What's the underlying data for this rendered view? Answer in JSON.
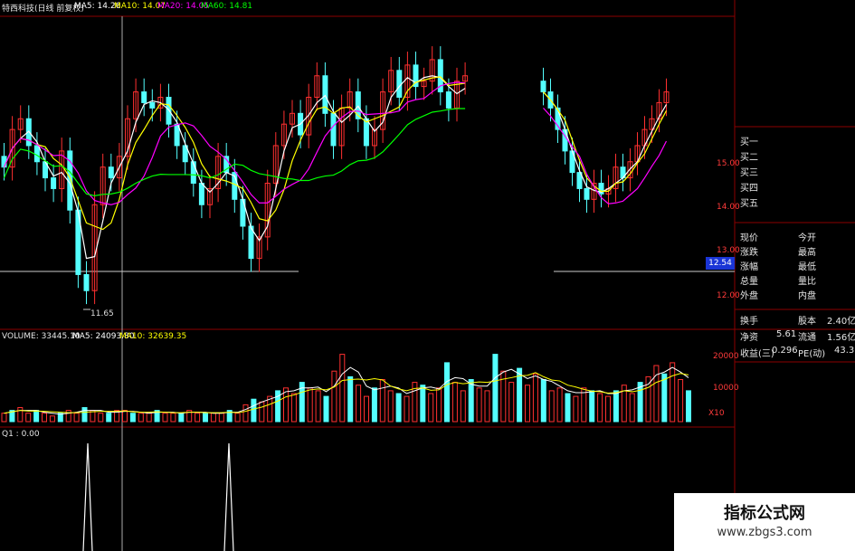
{
  "header": {
    "title": "特西科技(日线 前复权)",
    "ma5": "MA5: 14.26",
    "ma10": "MA10: 14.07",
    "ma20": "MA20: 14.05",
    "ma60": "MA60: 14.81"
  },
  "low_marker": "11.65",
  "current_price": "12.54",
  "price_axis": [
    "15.00",
    "14.00",
    "13.00",
    "12.00"
  ],
  "volume_header": {
    "volume": "VOLUME: 33445.10",
    "ma5": "MA5: 24093.80",
    "ma10": "MA10: 32639.35"
  },
  "volume_axis": [
    "20000",
    "10000",
    "X10"
  ],
  "indicator_header": "Q1 : 0.00",
  "side_panel": {
    "buy_levels": [
      "买一",
      "买二",
      "买三",
      "买四",
      "买五"
    ],
    "quote_rows": [
      {
        "left": "现价",
        "right": "今开"
      },
      {
        "left": "涨跌",
        "right": "最高"
      },
      {
        "left": "涨幅",
        "right": "最低"
      },
      {
        "left": "总量",
        "right": "量比"
      },
      {
        "left": "外盘",
        "right": "内盘"
      }
    ],
    "fund_rows": [
      {
        "left": "换手",
        "lval": "",
        "right": "股本",
        "rval": "2.40亿"
      },
      {
        "left": "净资",
        "lval": "5.61",
        "right": "流通",
        "rval": "1.56亿"
      },
      {
        "left": "收益(三)",
        "lval": "0.296",
        "right": "PE(动)",
        "rval": "43.3"
      }
    ]
  },
  "watermark": {
    "line1": "指标公式网",
    "line2": "www.zbgs3.com"
  },
  "colors": {
    "up": "#ff3030",
    "down": "#54ffff",
    "ma5": "#ffffff",
    "ma10": "#ffff00",
    "ma20": "#ff00ff",
    "ma60": "#00ff00",
    "grid": "#8b0000",
    "axis_text": "#ff3b3b"
  },
  "chart_data": {
    "type": "candlestick",
    "price_range": [
      11.5,
      16.3
    ],
    "close_series": [
      14.2,
      14.9,
      15.1,
      14.6,
      14.3,
      14.0,
      13.8,
      14.5,
      13.4,
      12.2,
      11.9,
      13.5,
      14.2,
      14.0,
      14.4,
      15.1,
      15.6,
      15.4,
      15.3,
      15.5,
      15.0,
      14.6,
      14.3,
      13.9,
      13.5,
      13.8,
      14.4,
      14.1,
      13.6,
      13.1,
      12.5,
      12.9,
      13.9,
      14.6,
      15.0,
      15.2,
      14.8,
      15.5,
      15.9,
      15.2,
      14.6,
      15.3,
      15.6,
      15.1,
      14.6,
      14.9,
      15.6,
      16.0,
      15.5,
      16.1,
      15.7,
      15.8,
      16.2,
      15.6,
      15.3,
      15.8,
      15.9
    ],
    "right_close_series": [
      15.6,
      15.3,
      14.9,
      14.5,
      14.1,
      13.8,
      13.6,
      13.9,
      13.7,
      13.8,
      14.2,
      14.0,
      14.3,
      14.6,
      14.9,
      15.1,
      15.4,
      15.6
    ],
    "volume_series": [
      3,
      4,
      5,
      3,
      4,
      3,
      2,
      3,
      4,
      3,
      5,
      4,
      3,
      3,
      4,
      4,
      3,
      3,
      3,
      4,
      3,
      3,
      3,
      4,
      3,
      3,
      3,
      3,
      4,
      3,
      6,
      8,
      7,
      9,
      11,
      12,
      10,
      14,
      12,
      11,
      9,
      18,
      24,
      16,
      13,
      9,
      12,
      15,
      11,
      10,
      9,
      14,
      13,
      10,
      12,
      21,
      14,
      11,
      15,
      12,
      11,
      24,
      18,
      14,
      19,
      13,
      17,
      15,
      11,
      12,
      10,
      9,
      12,
      11,
      10,
      9,
      11,
      13,
      10,
      14,
      16,
      20,
      17,
      21,
      15,
      11
    ]
  }
}
